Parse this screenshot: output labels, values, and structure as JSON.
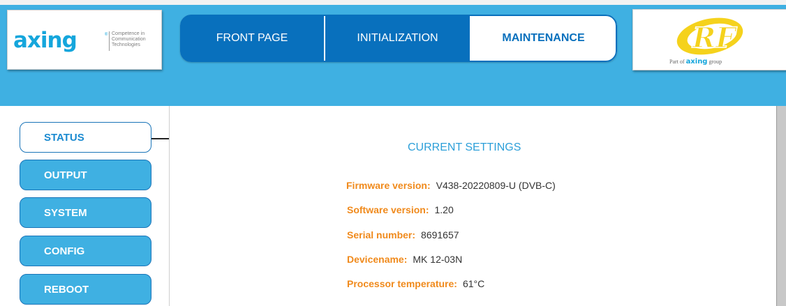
{
  "logo": {
    "brand": "axing",
    "reg_mark": "®",
    "tagline": [
      "Competence in",
      "Communication",
      "Technologies"
    ]
  },
  "nav": {
    "tabs": [
      {
        "label": "FRONT PAGE",
        "active": false
      },
      {
        "label": "INITIALIZATION",
        "active": false
      },
      {
        "label": "MAINTENANCE",
        "active": true
      }
    ]
  },
  "rf_logo": {
    "mark": "RF",
    "part_of": "Part of",
    "brand": "axing",
    "group": "group"
  },
  "sidebar": {
    "items": [
      {
        "label": "STATUS",
        "active": true
      },
      {
        "label": "OUTPUT",
        "active": false
      },
      {
        "label": "SYSTEM",
        "active": false
      },
      {
        "label": "CONFIG",
        "active": false
      },
      {
        "label": "REBOOT",
        "active": false
      }
    ]
  },
  "main": {
    "title": "CURRENT SETTINGS",
    "settings": [
      {
        "label": "Firmware version:",
        "value": "V438-20220809-U (DVB-C)"
      },
      {
        "label": "Software version:",
        "value": "1.20"
      },
      {
        "label": "Serial number:",
        "value": "8691657"
      },
      {
        "label": "Devicename:",
        "value": "MK 12-03N"
      },
      {
        "label": "Processor temperature:",
        "value": "61°C"
      }
    ]
  },
  "colors": {
    "header_blue": "#3fb0e2",
    "nav_dark_blue": "#0870bd",
    "label_orange": "#f08a1c",
    "title_blue": "#2c9fd9",
    "rf_yellow": "#f5d21c"
  }
}
